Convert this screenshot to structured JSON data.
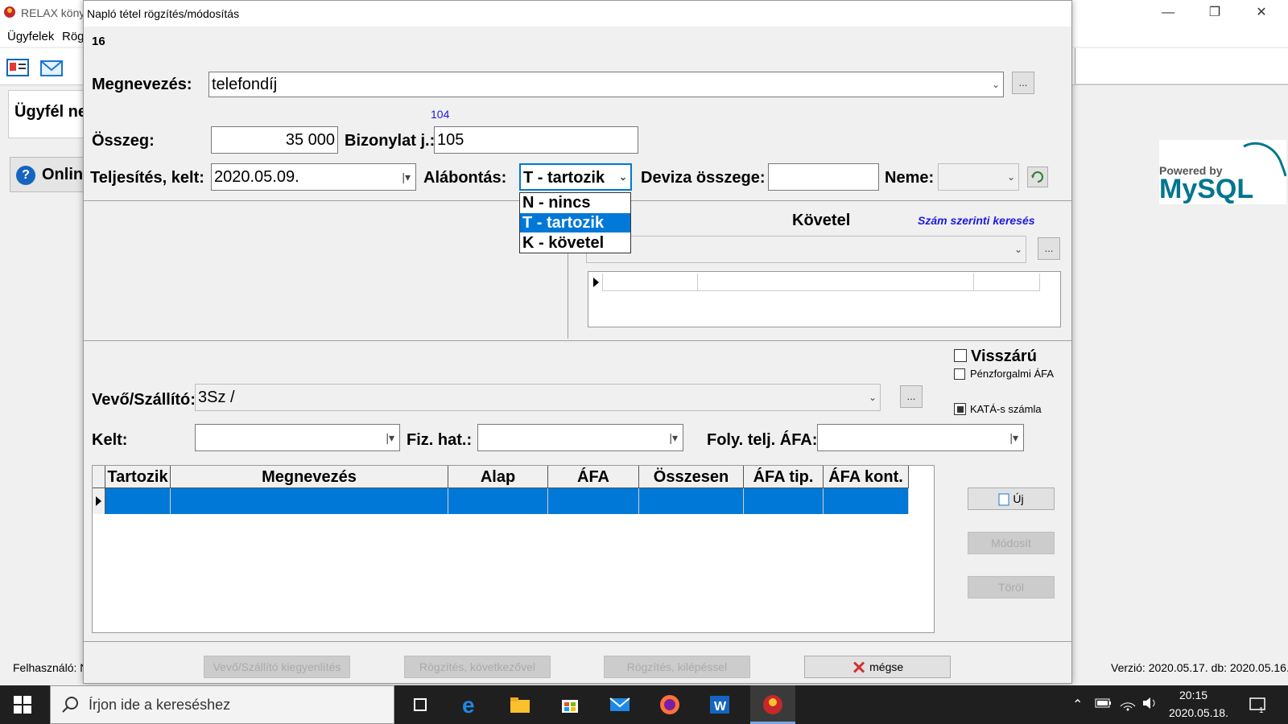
{
  "background_window": {
    "title": "RELAX köny",
    "menu": [
      "Ügyfelek",
      "Rög"
    ],
    "customer_label": "Ügyfél ne",
    "online_label": "Onlin",
    "user_label": "Felhasználó: N",
    "version_label": "Verzió: 2020.05.17. db: 2020.05.16.",
    "logo_text_powered": "Powered by",
    "logo_text_mysql": "MySQL"
  },
  "dialog": {
    "title": "Napló tétel rögzítés/módosítás",
    "record_id": "16",
    "megnevezes_label": "Megnevezés:",
    "megnevezes_value": "telefondíj",
    "more_btn": "...",
    "hint_number": "104",
    "osszeg_label": "Összeg:",
    "osszeg_value": "35 000",
    "bizonylat_label": "Bizonylat j.:",
    "bizonylat_value": "105",
    "teljesites_label": "Teljesítés, kelt:",
    "teljesites_value": "2020.05.09.",
    "alabontas_label": "Alábontás:",
    "alabontas_value": "T - tartozik",
    "alabontas_options": [
      "N - nincs",
      "T - tartozik",
      "K - követel"
    ],
    "deviza_label": "Deviza összege:",
    "deviza_value": "",
    "neme_label": "Neme:",
    "neme_value": "",
    "kovetel_label": "Követel",
    "szam_kereses_link": "Szám szerinti keresés",
    "visszaru_label": "Visszárú",
    "penzforgalmi_label": "Pénzforgalmi ÁFA",
    "kata_label": "KATÁ-s számla",
    "vevo_label": "Vevő/Szállító:",
    "vevo_value": "3Sz /",
    "kelt_label": "Kelt:",
    "kelt_value": "",
    "fizhat_label": "Fiz. hat.:",
    "fizhat_value": "",
    "foly_label": "Foly. telj. ÁFA:",
    "foly_value": "",
    "grid_columns": [
      "Tartozik",
      "Megnevezés",
      "Alap",
      "ÁFA",
      "Összesen",
      "ÁFA tip.",
      "ÁFA kont."
    ],
    "buttons": {
      "uj": "Új",
      "modosit": "Módosít",
      "torol": "Töröl",
      "kiegyenlites": "Vevő/Szállító kiegyenlítés",
      "rogzites_kovetkezo": "Rögzítés, következővel",
      "rogzites_kilepes": "Rögzítés, kilépéssel",
      "megse": "mégse"
    }
  },
  "taskbar": {
    "search_placeholder": "Írjon ide a kereséshez",
    "time": "20:15",
    "date": "2020.05.18."
  }
}
